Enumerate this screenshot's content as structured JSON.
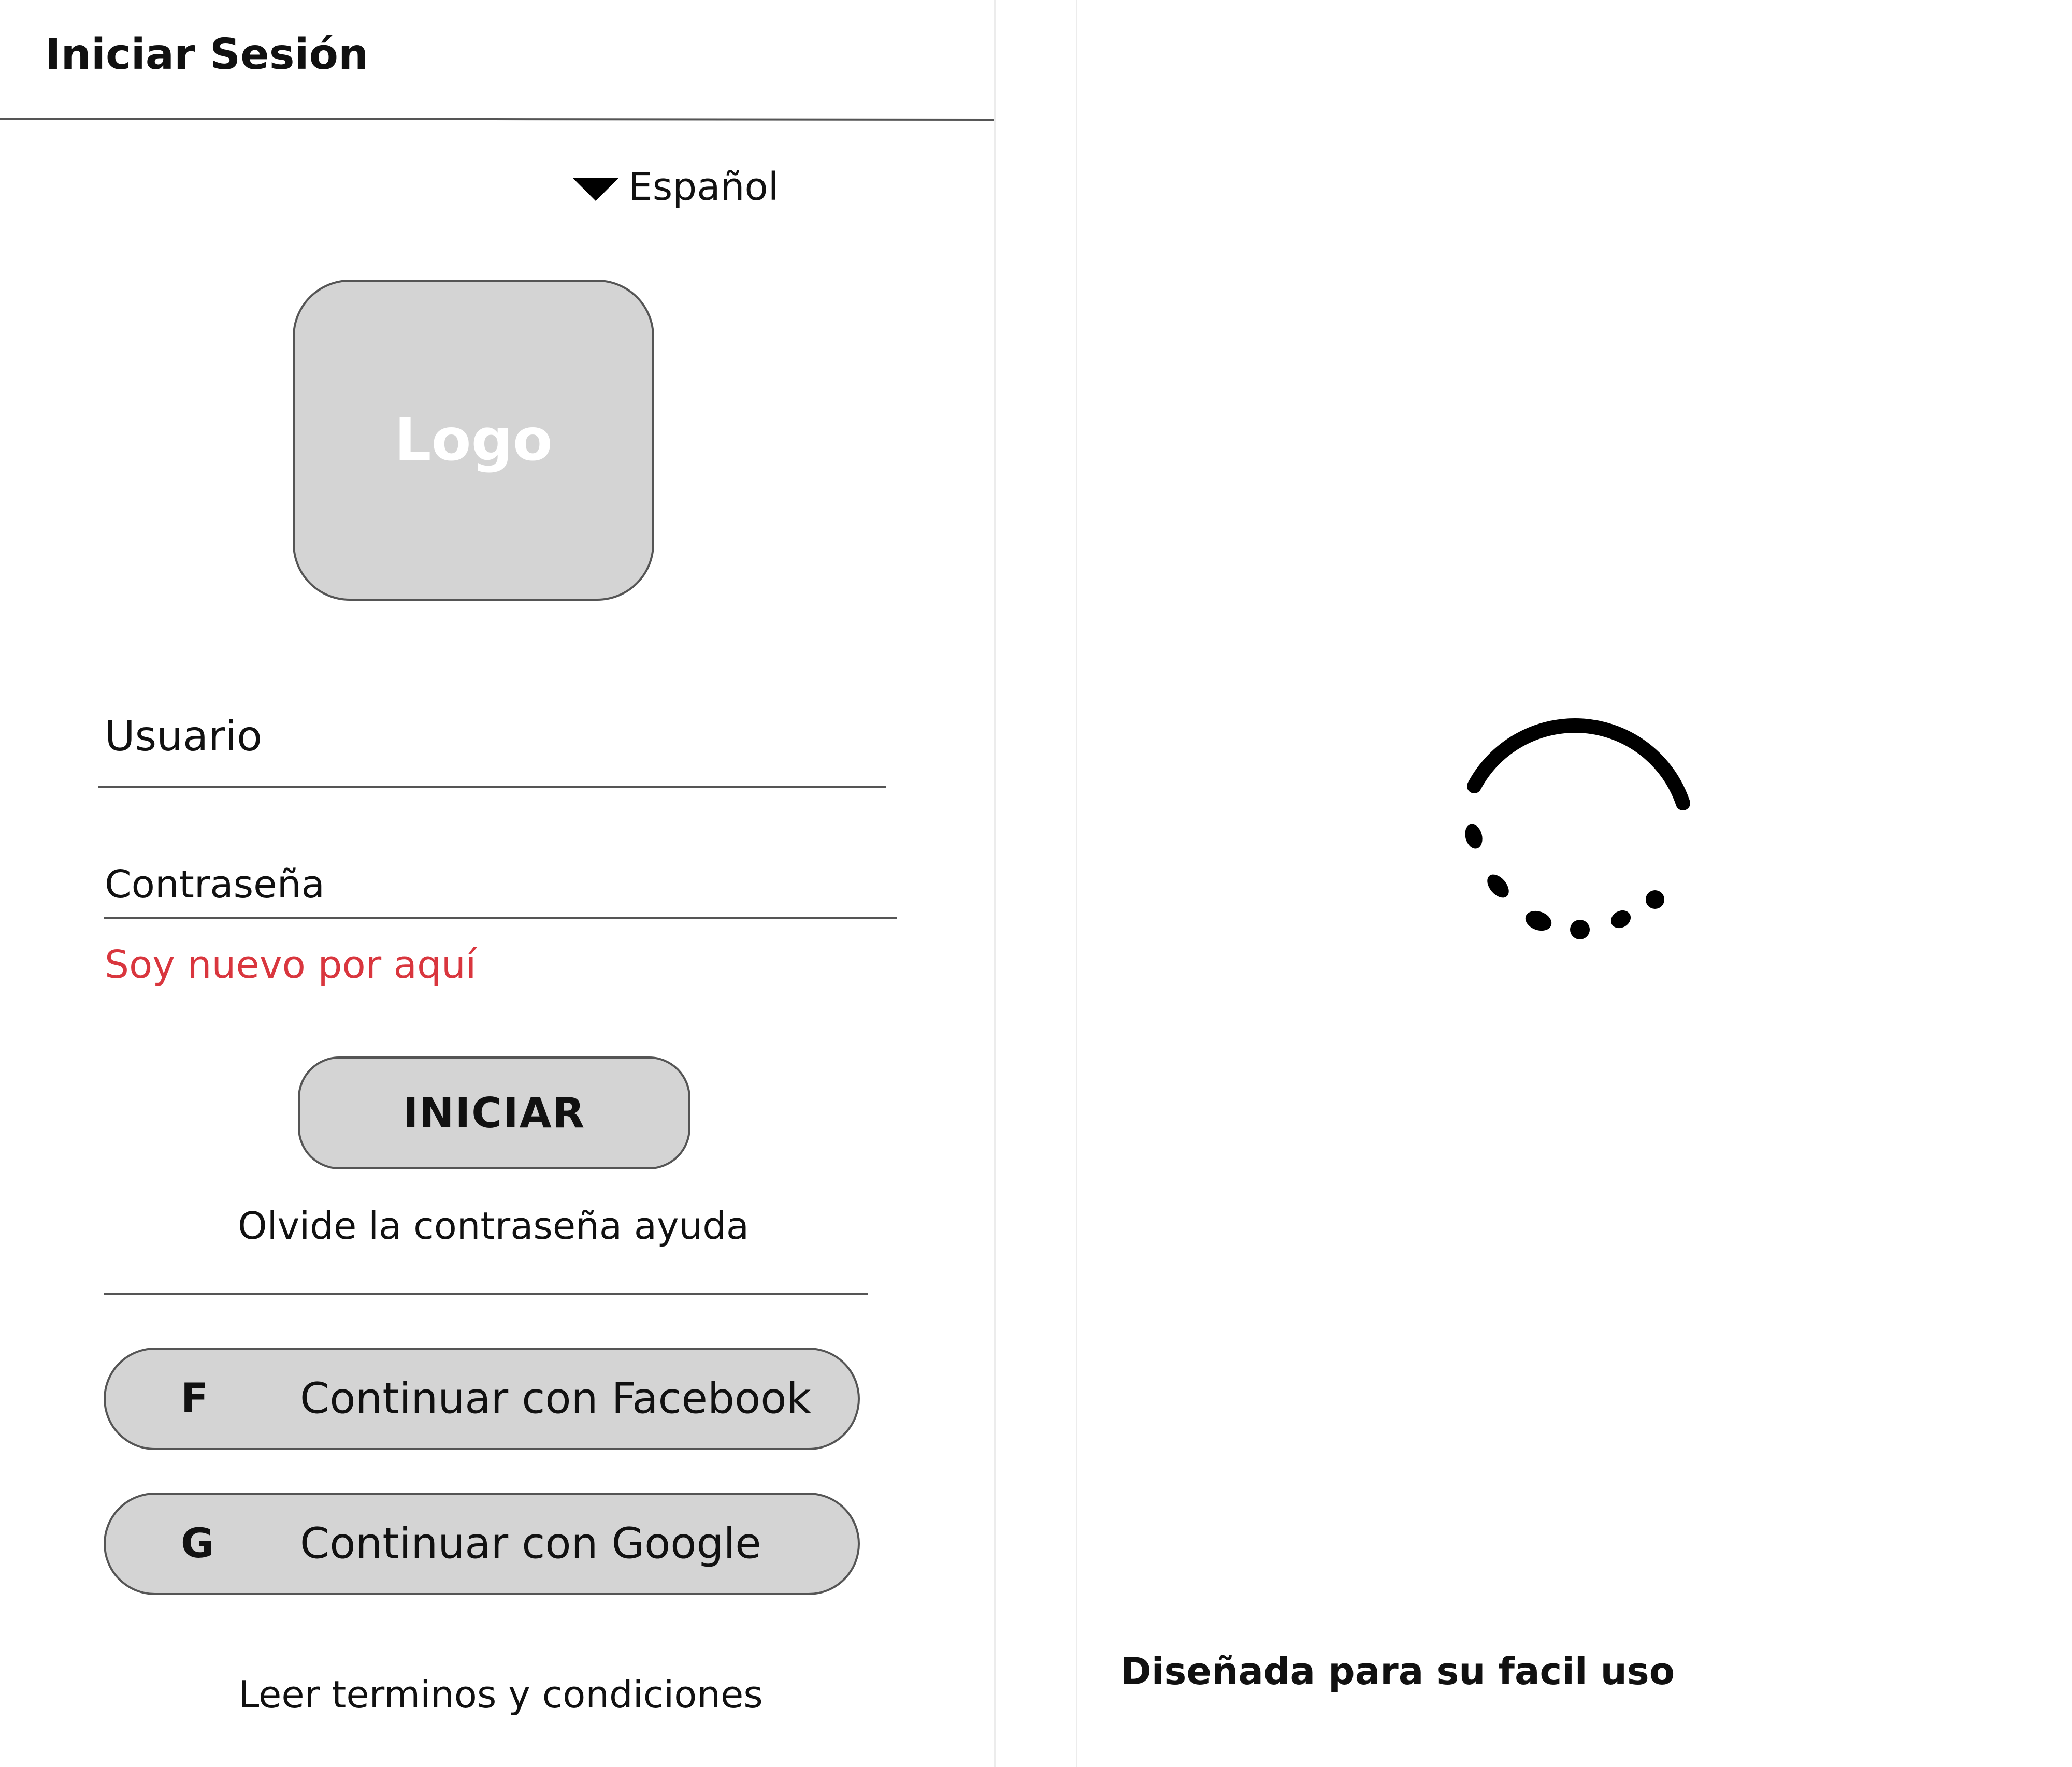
{
  "header": {
    "title": "Iniciar Sesión"
  },
  "language": {
    "selected": "Español",
    "icon": "chevron-down-icon"
  },
  "logo": {
    "text": "Logo"
  },
  "form": {
    "username_label": "Usuario",
    "password_label": "Contraseña",
    "new_user_link": "Soy nuevo por aquí",
    "login_button": "INICIAR",
    "forgot_link": "Olvide la contraseña ayuda"
  },
  "social": {
    "facebook": {
      "icon": "F",
      "label": "Continuar con Facebook"
    },
    "google": {
      "icon": "G",
      "label": "Continuar con Google"
    }
  },
  "footer": {
    "terms_link": "Leer terminos y condiciones"
  },
  "splash": {
    "tagline": "Diseñada para su facil uso",
    "loading_icon": "spinner-icon"
  },
  "colors": {
    "accent_link": "#d9363e",
    "button_fill": "#d4d4d4",
    "border": "#555555"
  }
}
